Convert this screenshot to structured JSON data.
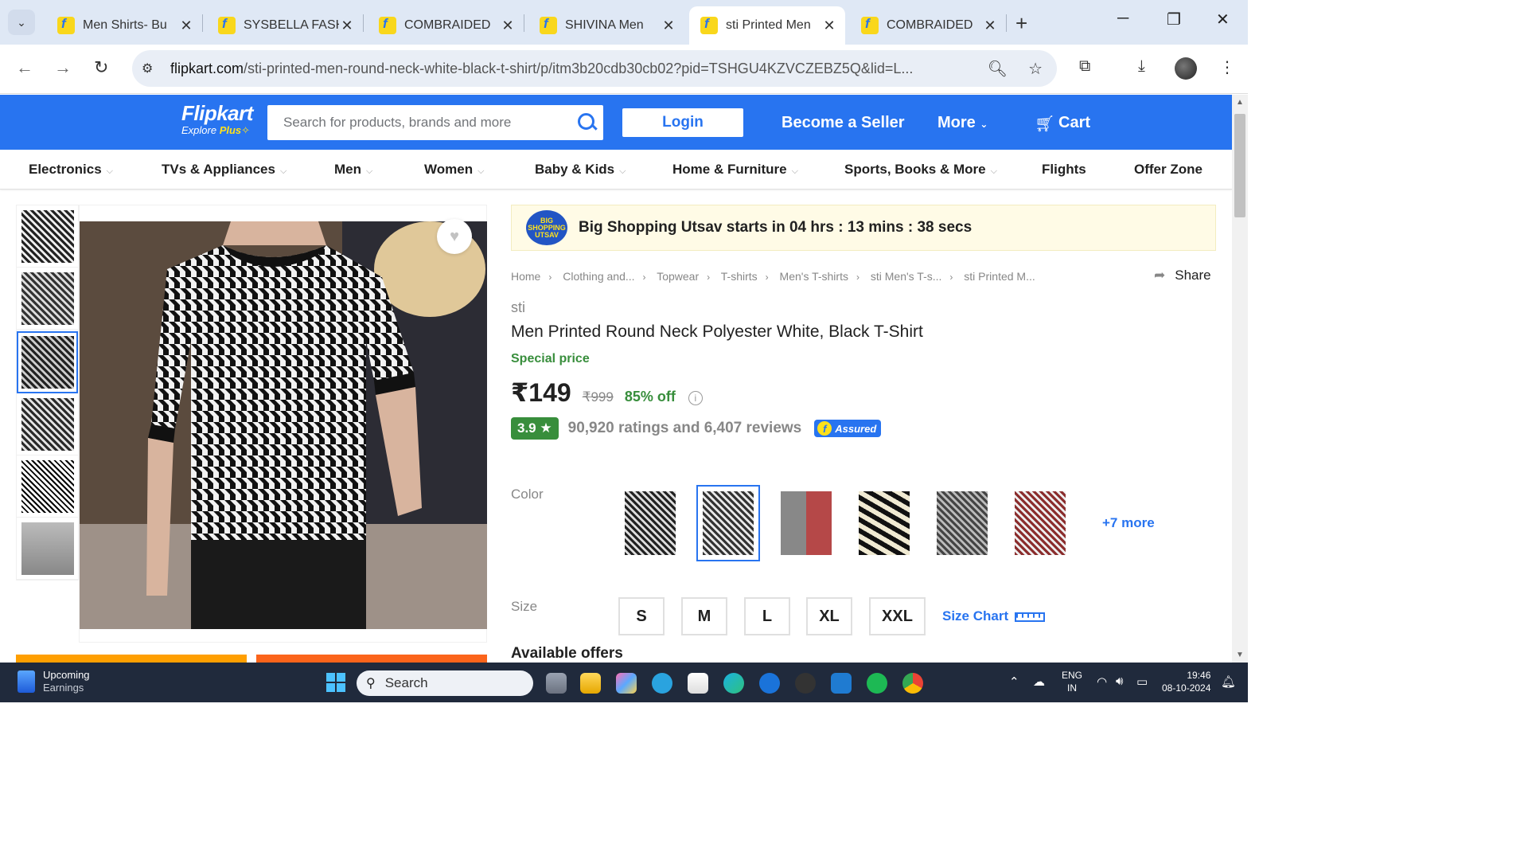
{
  "browser": {
    "tabs": [
      {
        "title": "Men Shirts- Bu",
        "active": false
      },
      {
        "title": "SYSBELLA FASH",
        "active": false
      },
      {
        "title": "COMBRAIDED",
        "active": false
      },
      {
        "title": "SHIVINA Men",
        "active": false
      },
      {
        "title": "sti Printed Men",
        "active": true
      },
      {
        "title": "COMBRAIDED",
        "active": false
      }
    ],
    "url_domain": "flipkart.com",
    "url_path": "/sti-printed-men-round-neck-white-black-t-shirt/p/itm3b20cdb30cb02?pid=TSHGU4KZVCZEBZ5Q&lid=L..."
  },
  "header": {
    "logo_name": "Flipkart",
    "logo_tag": "Explore",
    "logo_plus": "Plus",
    "search_placeholder": "Search for products, brands and more",
    "login": "Login",
    "become_seller": "Become a Seller",
    "more": "More",
    "cart": "Cart"
  },
  "categories": [
    "Electronics",
    "TVs & Appliances",
    "Men",
    "Women",
    "Baby & Kids",
    "Home & Furniture",
    "Sports, Books & More",
    "Flights",
    "Offer Zone"
  ],
  "product": {
    "banner_badge": "BIG SHOPPING UTSAV",
    "banner_text": "Big Shopping Utsav starts in 04 hrs : 13 mins : 38 secs",
    "breadcrumbs": [
      "Home",
      "Clothing and...",
      "Topwear",
      "T-shirts",
      "Men's T-shirts",
      "sti Men's T-s...",
      "sti Printed M..."
    ],
    "share": "Share",
    "brand": "sti",
    "title": "Men Printed Round Neck Polyester White, Black T-Shirt",
    "special_price": "Special price",
    "price": "₹149",
    "mrp": "₹999",
    "discount": "85% off",
    "rating": "3.9",
    "rating_text": "90,920 ratings and 6,407 reviews",
    "assured": "Assured",
    "color_label": "Color",
    "more_colors": "+7 more",
    "size_label": "Size",
    "sizes": [
      "S",
      "M",
      "L",
      "XL",
      "XXL"
    ],
    "size_chart": "Size Chart",
    "available_offers": "Available offers"
  },
  "taskbar": {
    "weather_title": "Upcoming",
    "weather_sub": "Earnings",
    "search": "Search",
    "lang_top": "ENG",
    "lang_bottom": "IN",
    "time": "19:46",
    "date": "08-10-2024"
  }
}
